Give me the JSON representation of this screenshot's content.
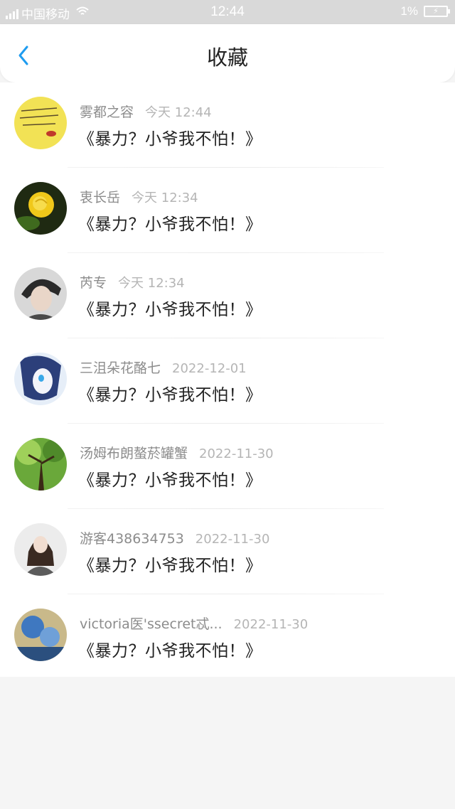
{
  "status_bar": {
    "carrier": "中国移动",
    "time": "12:44",
    "battery": "1%"
  },
  "header": {
    "title": "收藏"
  },
  "items": [
    {
      "name": "雾都之容",
      "time": "今天 12:44",
      "content": "《暴力？小爷我不怕！》"
    },
    {
      "name": "衷长岳",
      "time": "今天 12:34",
      "content": "《暴力？小爷我不怕！》"
    },
    {
      "name": "芮专",
      "time": "今天 12:34",
      "content": "《暴力？小爷我不怕！》"
    },
    {
      "name": "三沮朵花酪七",
      "time": "2022-12-01",
      "content": "《暴力？小爷我不怕！》"
    },
    {
      "name": "汤姆布朗螯菸罐蟹",
      "time": "2022-11-30",
      "content": "《暴力？小爷我不怕！》"
    },
    {
      "name": "游客438634753",
      "time": "2022-11-30",
      "content": "《暴力？小爷我不怕！》"
    },
    {
      "name": "victoria医'ssecret忒...",
      "time": "2022-11-30",
      "content": "《暴力？小爷我不怕！》"
    }
  ],
  "colors": {
    "accent": "#1e9cf0",
    "name_text": "#8c8c8c",
    "time_text": "#b5b5b5",
    "content_text": "#222222"
  },
  "icons": {
    "back": "chevron-left-icon",
    "signal": "signal-icon",
    "wifi": "wifi-icon",
    "battery": "battery-icon"
  }
}
